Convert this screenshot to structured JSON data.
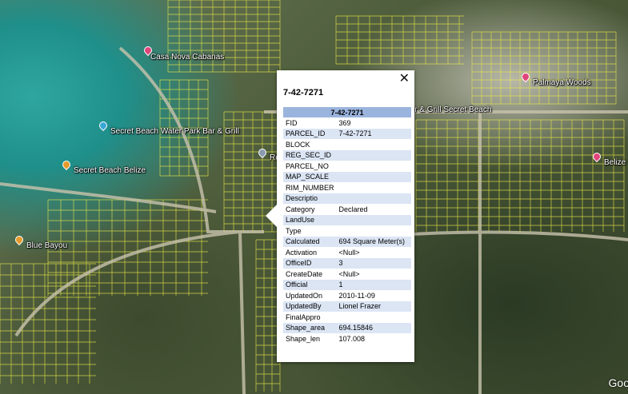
{
  "markers": [
    {
      "name": "Casa Nova Cabanas",
      "color": "#e0457b",
      "icon": "pink-pin-icon"
    },
    {
      "name": "Palmaya Woods",
      "color": "#e0457b",
      "icon": "pink-pin-icon"
    },
    {
      "name": "Secret Beach Water Park Bar & Grill",
      "color": "#3aa7d6",
      "icon": "blue-pin-icon"
    },
    {
      "name": "Secret Beach Belize",
      "color": "#e59a2c",
      "icon": "orange-pin-icon"
    },
    {
      "name": "Blue Bayou",
      "color": "#e59a2c",
      "icon": "orange-pin-icon"
    },
    {
      "name": "Bar & Grill Secret Beach",
      "color": "#e59a2c",
      "icon": "orange-pin-icon"
    },
    {
      "name": "Belize S",
      "color": "#e0457b",
      "icon": "pink-pin-icon"
    },
    {
      "name": "Rea",
      "color": "#8a9bb0",
      "icon": "gray-pin-icon"
    }
  ],
  "map_attribution": "Goo",
  "popup": {
    "close_label": "✕",
    "title": "7-42-7271",
    "table_header": "7-42-7271",
    "rows": [
      {
        "key": "FID",
        "value": "369"
      },
      {
        "key": "PARCEL_ID",
        "value": "7-42-7271"
      },
      {
        "key": "BLOCK",
        "value": ""
      },
      {
        "key": "REG_SEC_ID",
        "value": ""
      },
      {
        "key": "PARCEL_NO",
        "value": ""
      },
      {
        "key": "MAP_SCALE",
        "value": ""
      },
      {
        "key": "RIM_NUMBER",
        "value": ""
      },
      {
        "key": "Descriptio",
        "value": ""
      },
      {
        "key": "Category",
        "value": "Declared"
      },
      {
        "key": "LandUse",
        "value": ""
      },
      {
        "key": "Type",
        "value": ""
      },
      {
        "key": "Calculated",
        "value": "694 Square Meter(s)"
      },
      {
        "key": "Activation",
        "value": "<Null>"
      },
      {
        "key": "OfficeID",
        "value": "3"
      },
      {
        "key": "CreateDate",
        "value": "<Null>"
      },
      {
        "key": "Official",
        "value": "1"
      },
      {
        "key": "UpdatedOn",
        "value": "2010-11-09"
      },
      {
        "key": "UpdatedBy",
        "value": "Lionel Frazer"
      },
      {
        "key": "FinalAppro",
        "value": ""
      },
      {
        "key": "Shape_area",
        "value": "694.15846"
      },
      {
        "key": "Shape_len",
        "value": "107.008"
      }
    ]
  }
}
